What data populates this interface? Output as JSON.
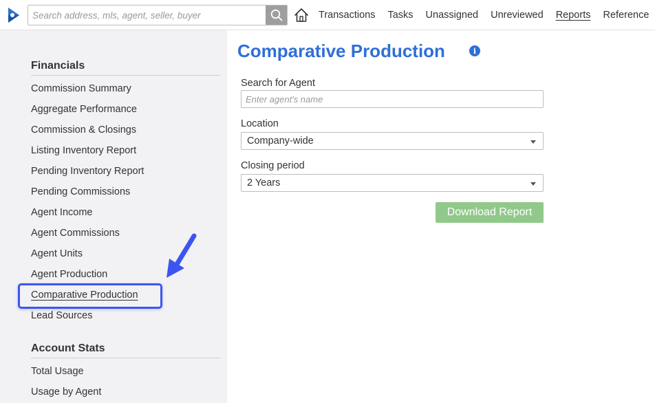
{
  "header": {
    "search_placeholder": "Search address, mls, agent, seller, buyer",
    "nav": [
      "Transactions",
      "Tasks",
      "Unassigned",
      "Unreviewed",
      "Reports",
      "Reference"
    ],
    "active_nav": "Reports"
  },
  "sidebar": {
    "financials_title": "Financials",
    "financials": [
      "Commission Summary",
      "Aggregate Performance",
      "Commission & Closings",
      "Listing Inventory Report",
      "Pending Inventory Report",
      "Pending Commissions",
      "Agent Income",
      "Agent Commissions",
      "Agent Units",
      "Agent Production",
      "Comparative Production",
      "Lead Sources"
    ],
    "active_item": "Comparative Production",
    "account_title": "Account Stats",
    "account": [
      "Total Usage",
      "Usage by Agent"
    ]
  },
  "main": {
    "title": "Comparative Production",
    "info_glyph": "i",
    "agent_label": "Search for Agent",
    "agent_placeholder": "Enter agent's name",
    "location_label": "Location",
    "location_value": "Company-wide",
    "period_label": "Closing period",
    "period_value": "2 Years",
    "download_label": "Download Report"
  },
  "colors": {
    "accent": "#2f6fd6",
    "download_button": "#90c98a",
    "highlight": "#3d55f0",
    "sidebar_bg": "#f2f2f4"
  }
}
